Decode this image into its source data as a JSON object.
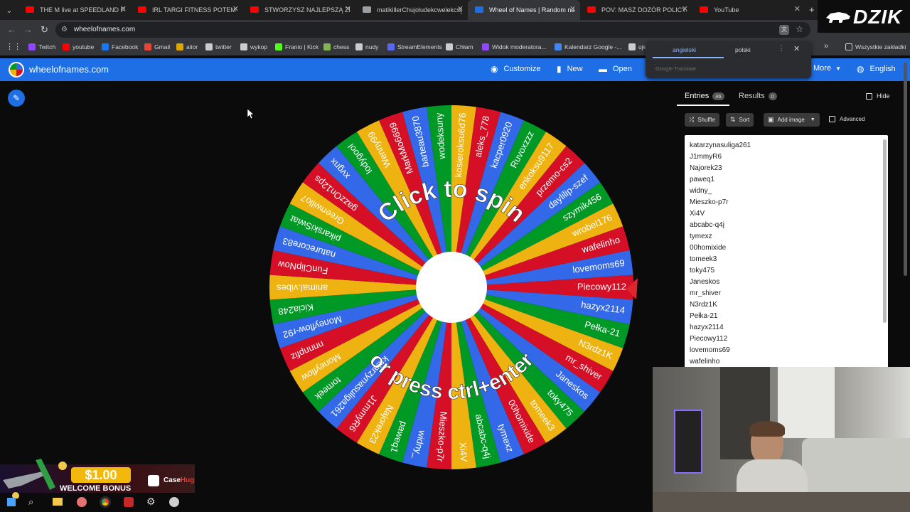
{
  "browser": {
    "tabs": [
      {
        "label": "THE M live at SPEEDLAND FEST",
        "favicon": "youtube-icon",
        "color": "#ff0000"
      },
      {
        "label": "IRL TARGI FITNESS POTEM SPO",
        "favicon": "youtube-icon",
        "color": "#ff0000"
      },
      {
        "label": "STWORZYSZ NAJLEPSZĄ ZBROI",
        "favicon": "youtube-icon",
        "color": "#ff0000"
      },
      {
        "label": "matikillerChujoludekcwelekcsg",
        "favicon": "page-icon",
        "color": "#9aa0a6"
      },
      {
        "label": "Wheel of Names | Random nam",
        "favicon": "wheel-icon",
        "color": "#1e6ee6",
        "active": true
      },
      {
        "label": "POV: MASZ DOZÓR POLICYJNY",
        "favicon": "youtube-icon",
        "color": "#ff0000"
      },
      {
        "label": "YouTube",
        "favicon": "youtube-icon",
        "color": "#ff0000"
      }
    ],
    "url": "wheelofnames.com",
    "bookmarks": [
      {
        "label": "Twitch",
        "color": "#9146ff"
      },
      {
        "label": "youtube",
        "color": "#ff0000"
      },
      {
        "label": "Facebook",
        "color": "#1877f2"
      },
      {
        "label": "Gmail",
        "color": "#ea4335"
      },
      {
        "label": "alior",
        "color": "#e0a500"
      },
      {
        "label": "twitter",
        "color": "#cccccc"
      },
      {
        "label": "wykop",
        "color": "#cccccc"
      },
      {
        "label": "Franio | Kick",
        "color": "#53fc18"
      },
      {
        "label": "chess",
        "color": "#81b64c"
      },
      {
        "label": "nudy",
        "color": "#cccccc"
      },
      {
        "label": "StreamElements",
        "color": "#5865f2"
      },
      {
        "label": "Chłam",
        "color": "#cccccc"
      },
      {
        "label": "Widok moderatora...",
        "color": "#9146ff"
      },
      {
        "label": "Kalendarz Google -...",
        "color": "#4285f4"
      },
      {
        "label": "uje",
        "color": "#cccccc"
      }
    ],
    "bookmarks_all": "Wszystkie zakładki",
    "overlay_logo": "DZIK"
  },
  "translate_popup": {
    "lang_from": "angielski",
    "lang_to": "polski",
    "footer": "Google Translate"
  },
  "header": {
    "site_name": "wheelofnames.com",
    "customize": "Customize",
    "new": "New",
    "open": "Open",
    "more": "More",
    "language": "English"
  },
  "wheel": {
    "center_text_top": "Click to spin",
    "center_text_bottom": "or press ctrl+enter",
    "colors": [
      "#d50f25",
      "#3369e8",
      "#009925",
      "#eeb211"
    ],
    "segment_labels": [
      "Piecowy112",
      "hazyx2114",
      "Pełka-21",
      "N3rdz1K",
      "mr_shiver",
      "Janeskos",
      "toky475",
      "tomeek3",
      "00homixide",
      "tymexz",
      "abcabc-q4j",
      "Xi4V",
      "Mieszko-p7r",
      "widny_",
      "paweq1",
      "Najorek23",
      "J1mmyR6",
      "katarzynasuliga261",
      "tomeek",
      "Moneyflow",
      "nnnnpfiz",
      "Moneyflow-r92",
      "Kicia248",
      "animal.vibes",
      "FunClipNow",
      "naturecore83",
      "pikarskiSwiat",
      "Greenwillo7",
      "gazzOn12ps",
      "xvgnx",
      "lodygool",
      "Wenny99",
      "MarkMo6699",
      "barteau3870",
      "wodeksuny",
      "kosieroksu6d76",
      "aleks_778",
      "kacper0920",
      "Ruvoxzzz",
      "enkoksu9117",
      "przemo-cs2",
      "daylilip-szef",
      "szymik456",
      "wrobel176",
      "wafelinho",
      "lovemoms69"
    ]
  },
  "panel": {
    "entries_tab": "Entries",
    "entries_count": "46",
    "results_tab": "Results",
    "results_count": "0",
    "hide": "Hide",
    "shuffle": "Shuffle",
    "sort": "Sort",
    "add_image": "Add image",
    "advanced": "Advanced",
    "entries": [
      "katarzynasuliga261",
      "J1mmyR6",
      "Najorek23",
      "paweq1",
      "widny_",
      "Mieszko-p7r",
      "Xi4V",
      "abcabc-q4j",
      "tymexz",
      "00homixide",
      "tomeek3",
      "toky475",
      "Janeskos",
      "mr_shiver",
      "N3rdz1K",
      "Pełka-21",
      "hazyx2114",
      "Piecowy112",
      "lovemoms69",
      "wafelinho"
    ]
  },
  "overlays": {
    "bonus_amount": "$1.00",
    "bonus_text": "WELCOME BONUS",
    "bonus_brand_a": "Case",
    "bonus_brand_b": "Hug"
  }
}
